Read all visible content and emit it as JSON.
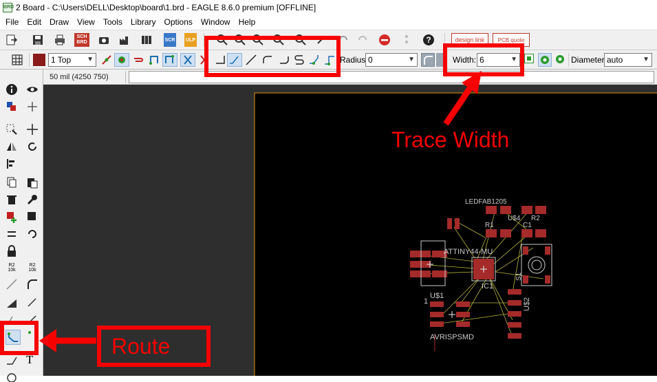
{
  "window": {
    "title": "2 Board - C:\\Users\\DELL\\Desktop\\board\\1.brd - EAGLE 8.6.0 premium [OFFLINE]",
    "app_icon_text": "BRD"
  },
  "menu": [
    "File",
    "Edit",
    "Draw",
    "View",
    "Tools",
    "Library",
    "Options",
    "Window",
    "Help"
  ],
  "toolbar1": {
    "sch_brd_label": "SCH BRD",
    "scr_label": "SCR",
    "ulp_label": "ULP",
    "design_link_label": "design link",
    "pcb_quote_label": "PCB quote"
  },
  "toolbar2": {
    "layer_value": "1 Top",
    "radius_label": "Radius:",
    "radius_value": "0",
    "width_label": "Width:",
    "width_value": "6",
    "diameter_label": "Diameter:",
    "diameter_value": "auto"
  },
  "leftbar": {
    "r2_top": "R2",
    "r2_sub1": "10k",
    "r2_sub2": "10k",
    "text_tool": "T"
  },
  "statusbar": {
    "coordinates": "50 mil (4250 750)",
    "command_value": ""
  },
  "board": {
    "labels": {
      "ledfab": "LEDFAB1205",
      "u34": "U$4",
      "r1": "R1",
      "r2": "R2",
      "c1": "C1",
      "ic1_name": "ATTINY44-MU",
      "ic1": "IC1",
      "u1": "U$1",
      "one": "1",
      "s1": "S1",
      "u2": "U$2",
      "avr": "AVRISPSMD"
    },
    "pad_color": "#a52a2a",
    "trace_color": "#b8b43c",
    "outline_color": "#e59400"
  },
  "annotations": {
    "trace_width_label": "Trace Width",
    "route_label": "Route",
    "color": "#f70000"
  }
}
